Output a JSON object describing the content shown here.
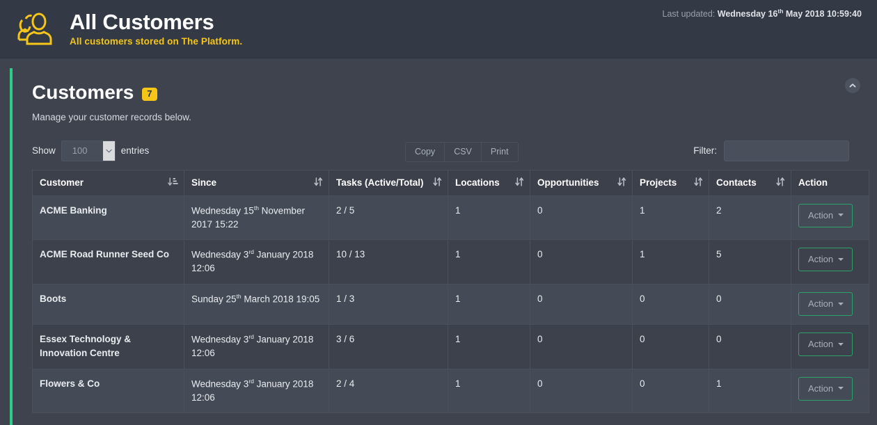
{
  "header": {
    "title": "All Customers",
    "subtitle": "All customers stored on The Platform.",
    "icon": "users-icon",
    "last_updated_label": "Last updated:",
    "last_updated_value_pre": "Wednesday 16",
    "last_updated_ordinal": "th",
    "last_updated_value_post": " May 2018 10:59:40"
  },
  "card": {
    "title": "Customers",
    "count_badge": "7",
    "description": "Manage your customer records below.",
    "collapse_icon": "chevron-up-icon",
    "accent_color": "#2ecc84"
  },
  "toolbar": {
    "length_label_pre": "Show",
    "length_value": "100",
    "length_label_post": "entries",
    "length_options": [
      "100"
    ],
    "export_buttons": [
      "Copy",
      "CSV",
      "Print"
    ],
    "filter_label": "Filter:",
    "filter_value": "",
    "filter_placeholder": ""
  },
  "table": {
    "columns": [
      {
        "label": "Customer",
        "sort": "asc"
      },
      {
        "label": "Since",
        "sort": "none"
      },
      {
        "label": "Tasks (Active/Total)",
        "sort": "none"
      },
      {
        "label": "Locations",
        "sort": "none"
      },
      {
        "label": "Opportunities",
        "sort": "none"
      },
      {
        "label": "Projects",
        "sort": "none"
      },
      {
        "label": "Contacts",
        "sort": "none"
      },
      {
        "label": "Action",
        "sort": null
      }
    ],
    "action_label": "Action",
    "rows": [
      {
        "customer": "ACME Banking",
        "since_pre": "Wednesday 15",
        "since_ordinal": "th",
        "since_post": " November 2017 15:22",
        "tasks": "2 / 5",
        "locations": "1",
        "opportunities": "0",
        "projects": "1",
        "contacts": "2"
      },
      {
        "customer": "ACME Road Runner Seed Co",
        "since_pre": "Wednesday 3",
        "since_ordinal": "rd",
        "since_post": " January 2018 12:06",
        "tasks": "10 / 13",
        "locations": "1",
        "opportunities": "0",
        "projects": "1",
        "contacts": "5"
      },
      {
        "customer": "Boots",
        "since_pre": "Sunday 25",
        "since_ordinal": "th",
        "since_post": " March 2018 19:05",
        "tasks": "1 / 3",
        "locations": "1",
        "opportunities": "0",
        "projects": "0",
        "contacts": "0"
      },
      {
        "customer": "Essex Technology & Innovation Centre",
        "since_pre": "Wednesday 3",
        "since_ordinal": "rd",
        "since_post": " January 2018 12:06",
        "tasks": "3 / 6",
        "locations": "1",
        "opportunities": "0",
        "projects": "0",
        "contacts": "0"
      },
      {
        "customer": "Flowers & Co",
        "since_pre": "Wednesday 3",
        "since_ordinal": "rd",
        "since_post": " January 2018 12:06",
        "tasks": "2 / 4",
        "locations": "1",
        "opportunities": "0",
        "projects": "0",
        "contacts": "1"
      }
    ]
  }
}
